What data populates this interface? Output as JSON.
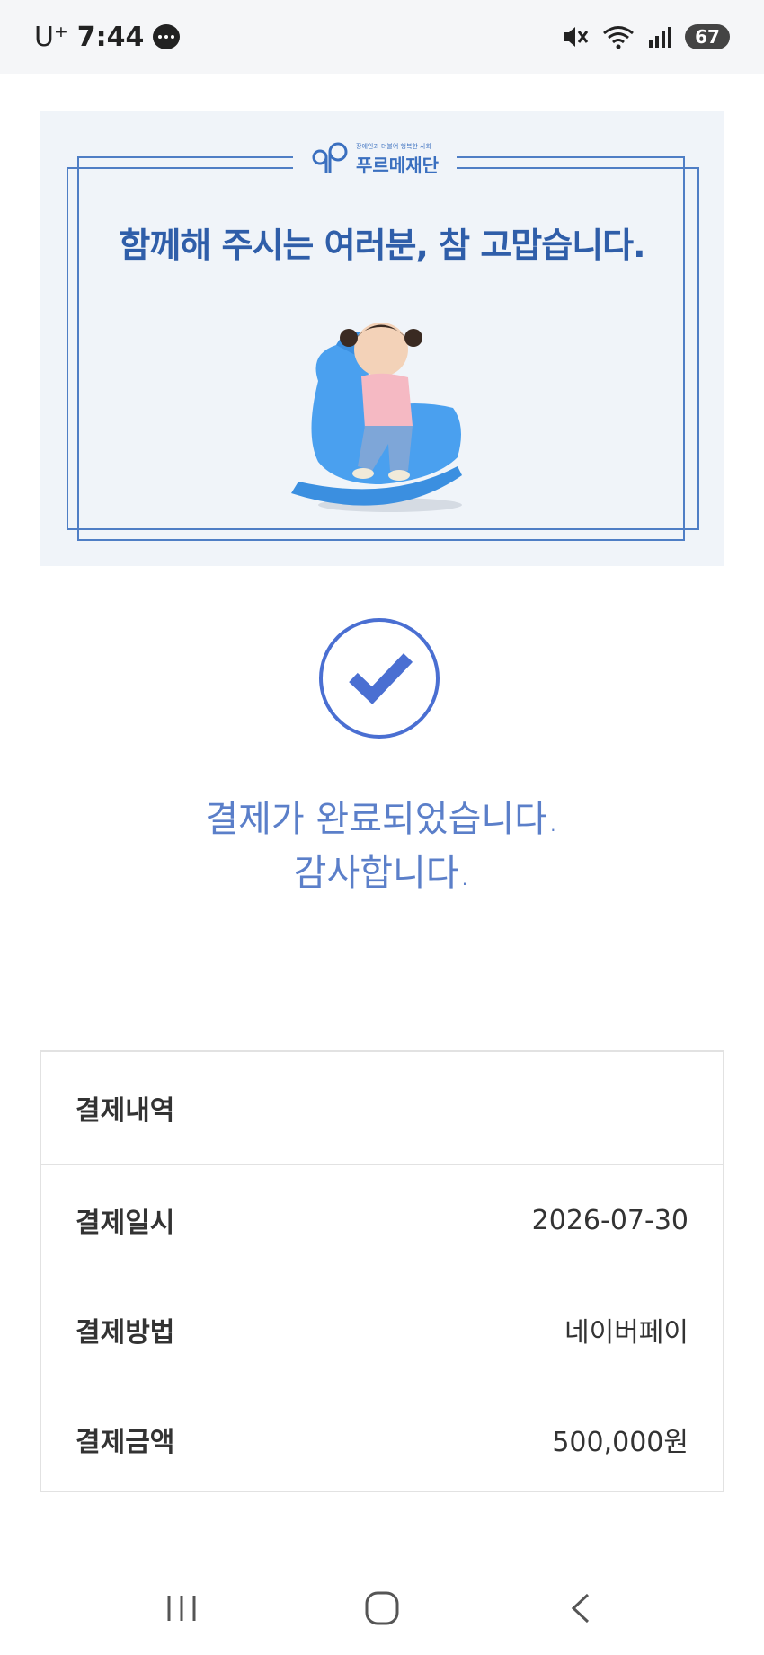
{
  "status_bar": {
    "carrier": "U⁺",
    "time": "7:44",
    "battery": "67",
    "icons": [
      "chat-bubble-icon",
      "mute-icon",
      "wifi-icon",
      "signal-icon",
      "battery-icon"
    ]
  },
  "banner": {
    "logo_tagline": "장애인과 더불어 행복한 사회",
    "logo_name": "푸르메재단",
    "headline": "함께해 주시는 여러분, 참 고맙습니다."
  },
  "confirmation": {
    "line1": "결제가 완료되었습니다.",
    "line2": "감사합니다."
  },
  "receipt": {
    "title": "결제내역",
    "rows": [
      {
        "label": "결제일시",
        "value": "2026-07-30"
      },
      {
        "label": "결제방법",
        "value": "네이버페이"
      },
      {
        "label": "결제금액",
        "value": "500,000원"
      }
    ]
  },
  "nav_bar": {
    "buttons": [
      "recent-apps-icon",
      "home-icon",
      "back-icon"
    ]
  },
  "colors": {
    "accent": "#4a6fd2",
    "banner_text": "#2f5ea9",
    "message_text": "#5b7fc9"
  }
}
